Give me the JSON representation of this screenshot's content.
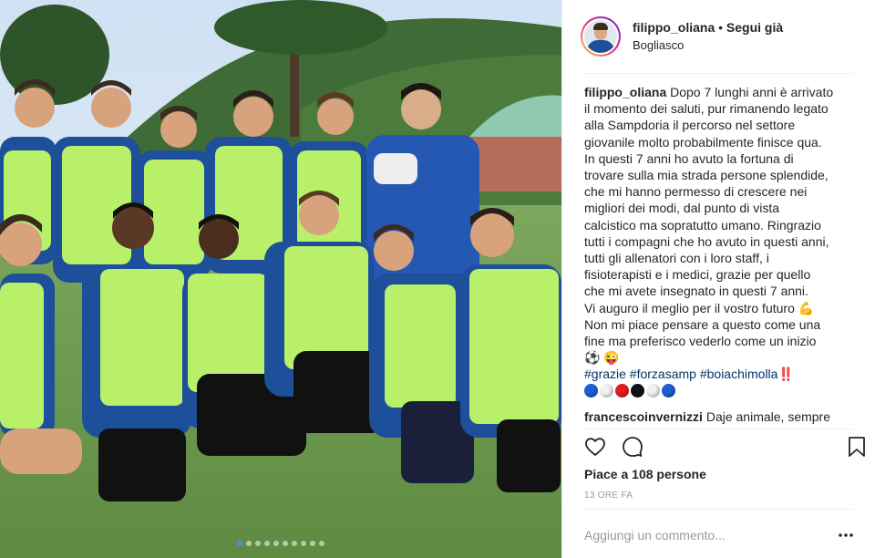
{
  "post": {
    "username": "filippo_oliana",
    "separator": "•",
    "follow_status": "Segui già",
    "location": "Bogliasco",
    "caption_lines": [
      "Dopo 7 lunghi anni è arrivato",
      "il momento dei saluti, pur rimanendo legato",
      "alla Sampdoria il percorso nel settore",
      "giovanile molto probabilmente finisce qua.",
      "In questi 7 anni ho avuto la fortuna di",
      "trovare sulla mia strada persone splendide,",
      "che mi hanno permesso di crescere nei",
      "migliori dei modi, dal punto di vista",
      "calcistico ma sopratutto umano. Ringrazio",
      "tutti i compagni che ho avuto in questi anni,",
      "tutti gli allenatori con i loro staff, i",
      "fisioterapisti e i medici, grazie per quello",
      "che mi avete insegnato in questi 7 anni.",
      "Vi auguro il meglio per il vostro futuro",
      "Non mi piace pensare a questo come una",
      "fine ma preferisco vederlo come un inizio"
    ],
    "hashtags": "#grazie #forzasamp #boiachimolla",
    "hashtag_suffix": "‼️",
    "emoji_flexed": "💪",
    "emoji_ball": "⚽",
    "emoji_wink": "😜",
    "flag_balls": [
      "#1f5fd1",
      "#f2f2f2",
      "#e02020",
      "#111111",
      "#f2f2f2",
      "#1f5fd1"
    ],
    "comment": {
      "username": "francescoinvernizzi",
      "text": "Daje animale, sempre"
    },
    "likes_text": "Piace a 108 persone",
    "time_text": "13 ORE FA",
    "comment_placeholder": "Aggiungi un commento...",
    "icons": {
      "like": "heart-icon",
      "comment": "comment-icon",
      "save": "bookmark-icon",
      "more": "more-options-icon"
    }
  },
  "carousel": {
    "dot_count": 10,
    "active_index": 0
  },
  "colors": {
    "accent_blue": "#3897f0",
    "text": "#262626",
    "muted": "#999999",
    "hashtag": "#003569",
    "bib_green": "#b8f06a",
    "sampdoria_blue": "#1d4f9a"
  }
}
